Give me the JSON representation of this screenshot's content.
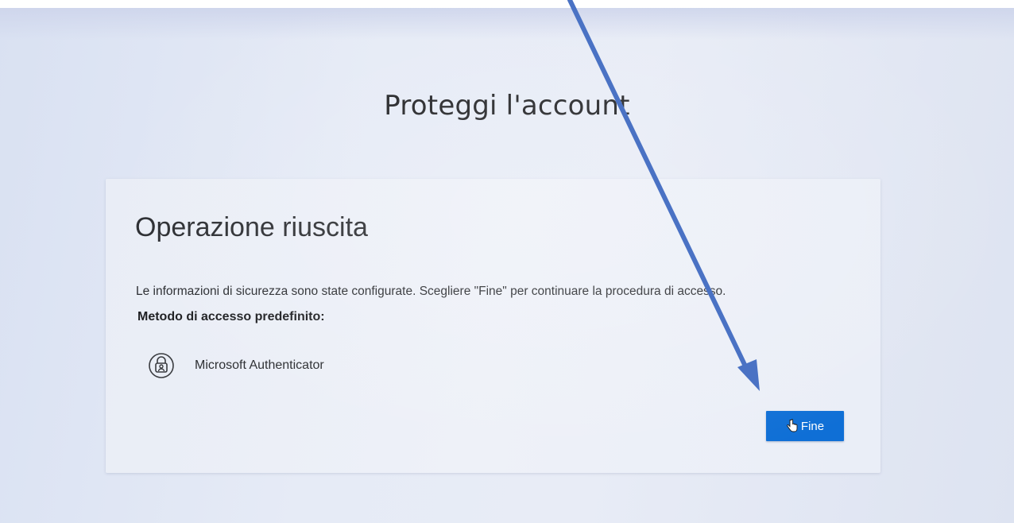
{
  "page": {
    "title": "Proteggi l'account"
  },
  "card": {
    "heading": "Operazione riuscita",
    "message": "Le informazioni di sicurezza sono state configurate. Scegliere \"Fine\" per continuare la procedura di accesso.",
    "method_label": "Metodo di accesso predefinito:",
    "method": {
      "icon": "authenticator-lock-icon",
      "name": "Microsoft Authenticator"
    },
    "finish_button_label": "Fine"
  },
  "colors": {
    "button": "#0f6fd6",
    "annotation_arrow": "#4a72c4"
  }
}
